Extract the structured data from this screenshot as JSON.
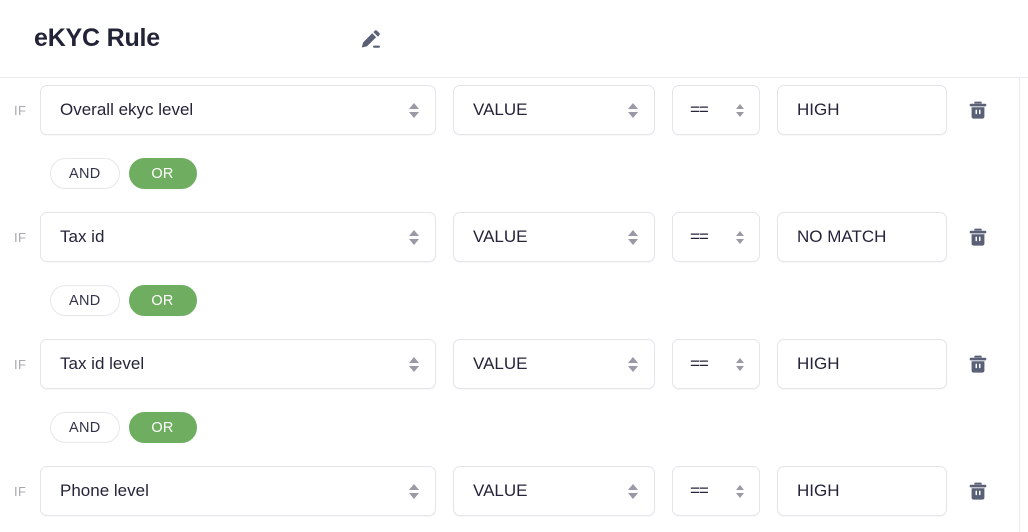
{
  "header": {
    "title": "eKYC Rule",
    "edit_icon": "pencil-edit-icon"
  },
  "theme": {
    "accent_green": "#6fae60",
    "title_color": "#232338",
    "border_color": "#e4e4ea",
    "if_label_color": "#a8a8b3",
    "icon_color": "#5a6076"
  },
  "labels": {
    "if": "IF",
    "and": "AND",
    "or": "OR",
    "delete_icon": "trash-icon",
    "stepper_icon": "select-stepper-icon"
  },
  "rules": [
    {
      "if": "IF",
      "attribute": "Overall ekyc level",
      "source": "VALUE",
      "operator": "==",
      "value": "HIGH",
      "conjunction": {
        "and": "AND",
        "or": "OR",
        "selected": "OR"
      }
    },
    {
      "if": "IF",
      "attribute": "Tax id",
      "source": "VALUE",
      "operator": "==",
      "value": "NO MATCH",
      "conjunction": {
        "and": "AND",
        "or": "OR",
        "selected": "OR"
      }
    },
    {
      "if": "IF",
      "attribute": "Tax id level",
      "source": "VALUE",
      "operator": "==",
      "value": "HIGH",
      "conjunction": {
        "and": "AND",
        "or": "OR",
        "selected": "OR"
      }
    },
    {
      "if": "IF",
      "attribute": "Phone level",
      "source": "VALUE",
      "operator": "==",
      "value": "HIGH",
      "conjunction": null
    }
  ]
}
